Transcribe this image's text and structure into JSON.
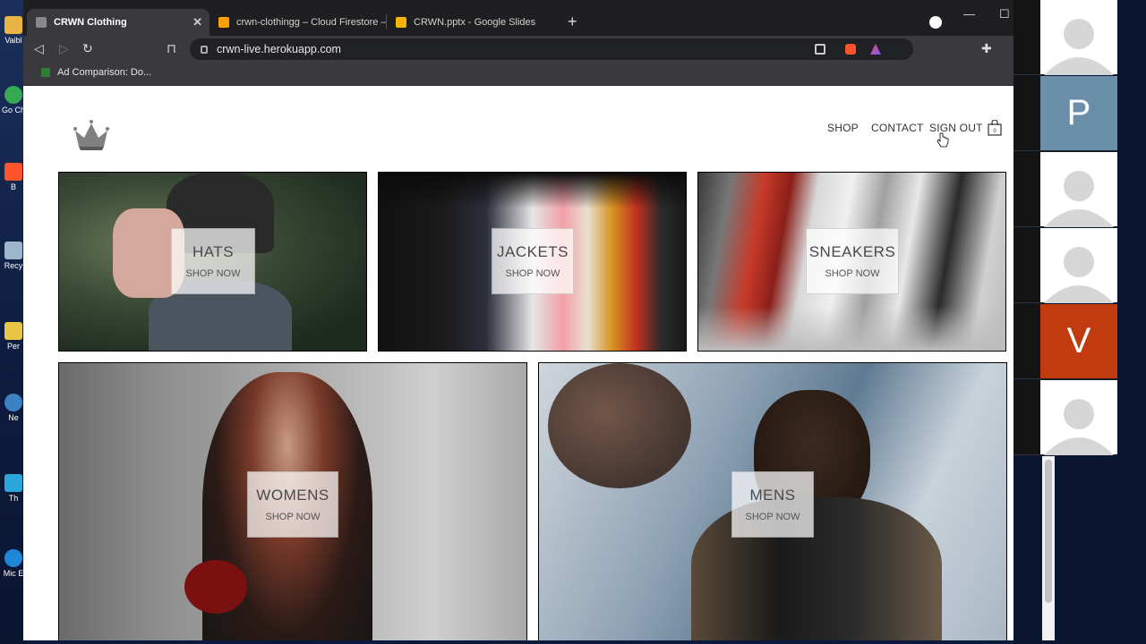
{
  "browser": {
    "tabs": [
      {
        "title": "CRWN Clothing",
        "active": true
      },
      {
        "title": "crwn-clothingg – Cloud Firestore – Fir",
        "active": false
      },
      {
        "title": "CRWN.pptx - Google Slides",
        "active": false
      }
    ],
    "url": "crwn-live.herokuapp.com",
    "bookmark": "Ad Comparison: Do...",
    "brave_badge": "5"
  },
  "desktop_icons": [
    "Vaibl",
    "Go Ch",
    "B",
    "Recy",
    "Per",
    "Ne",
    "Th",
    "Mic E"
  ],
  "site": {
    "nav": {
      "shop": "SHOP",
      "contact": "CONTACT",
      "sign_out": "SIGN OUT"
    },
    "cart_count": "0",
    "directory": [
      {
        "title": "HATS",
        "cta": "SHOP NOW"
      },
      {
        "title": "JACKETS",
        "cta": "SHOP NOW"
      },
      {
        "title": "SNEAKERS",
        "cta": "SHOP NOW"
      },
      {
        "title": "WOMENS",
        "cta": "SHOP NOW"
      },
      {
        "title": "MENS",
        "cta": "SHOP NOW"
      }
    ]
  },
  "participants": [
    {
      "initial": "",
      "color": "#ffffff"
    },
    {
      "initial": "P",
      "color": "#6b8fa8"
    },
    {
      "initial": "",
      "color": "#ffffff"
    },
    {
      "initial": "",
      "color": "#ffffff"
    },
    {
      "initial": "V",
      "color": "#c23b0f"
    },
    {
      "initial": "",
      "color": "#ffffff"
    }
  ]
}
